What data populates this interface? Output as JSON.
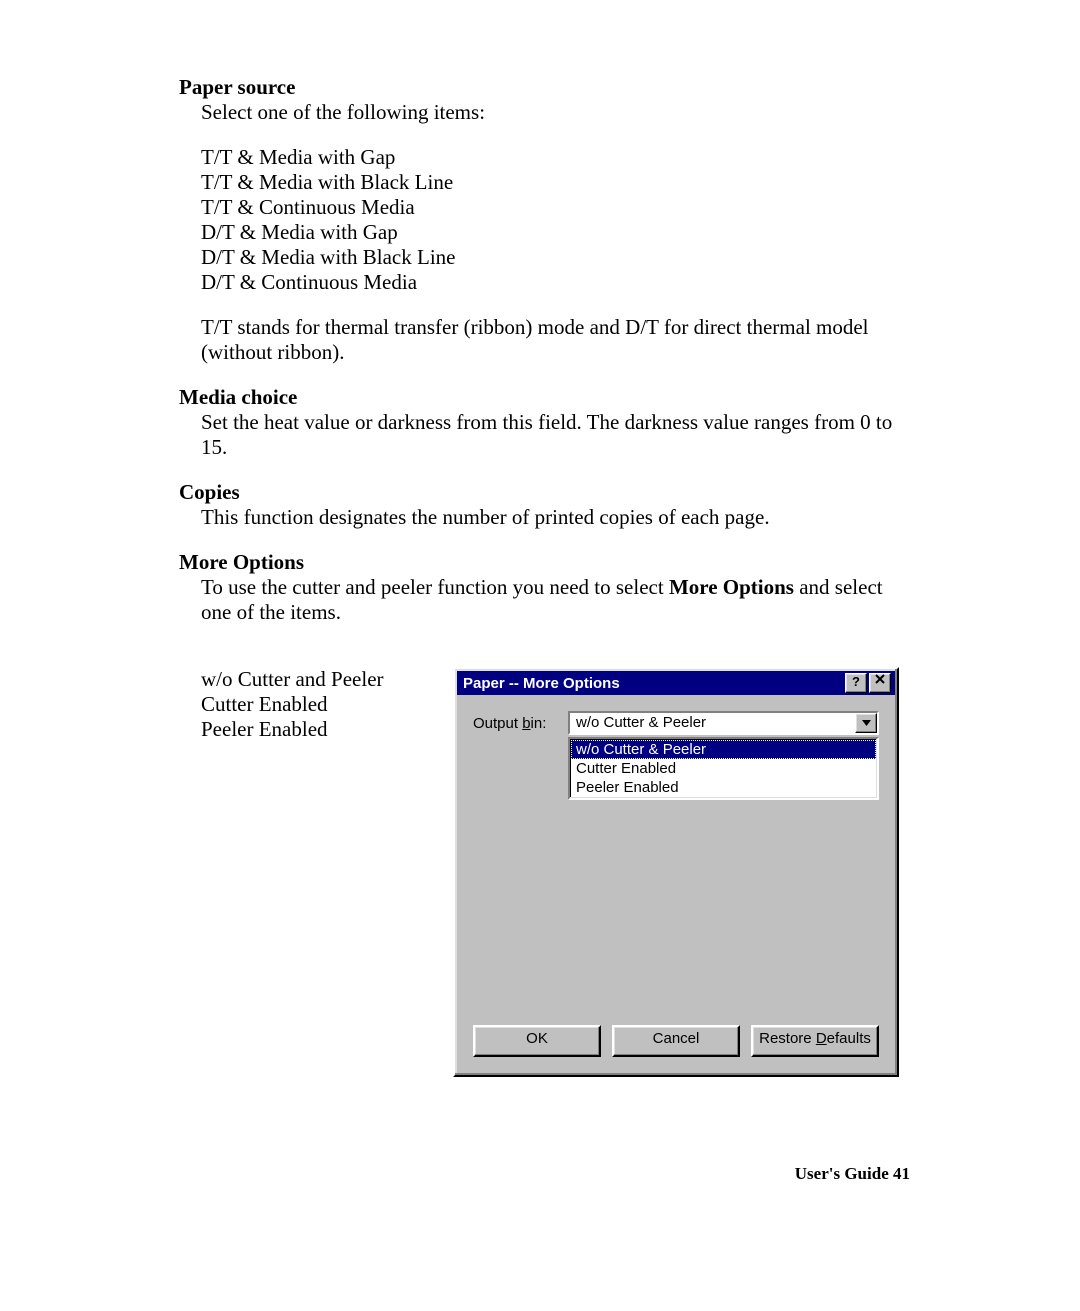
{
  "sections": {
    "paper_source": {
      "heading": "Paper source",
      "intro": "Select one of the following items:",
      "items": [
        "T/T & Media with Gap",
        "T/T & Media with Black Line",
        "T/T & Continuous Media",
        "D/T & Media with Gap",
        "D/T & Media with Black Line",
        "D/T & Continuous Media"
      ],
      "note": "T/T stands for thermal transfer (ribbon) mode and D/T for direct thermal model (without ribbon)."
    },
    "media_choice": {
      "heading": "Media choice",
      "text": "Set the heat value or darkness from this field.  The darkness value ranges from 0 to 15."
    },
    "copies": {
      "heading": "Copies",
      "text": "This function designates the number of printed copies of each page."
    },
    "more_options": {
      "heading": "More Options",
      "text_pre": "To use the cutter and peeler function you need to select ",
      "text_bold": "More Options",
      "text_post": " and select one of the items.",
      "left_items": [
        "w/o Cutter and Peeler",
        "Cutter Enabled",
        "Peeler Enabled"
      ]
    }
  },
  "dialog": {
    "title": "Paper -- More Options",
    "help_btn": "?",
    "close_btn": "×",
    "output_bin_label_pre": "Output ",
    "output_bin_label_ul": "b",
    "output_bin_label_post": "in:",
    "combo_selected": "w/o Cutter & Peeler",
    "dropdown": [
      {
        "text": "w/o Cutter & Peeler",
        "selected": true
      },
      {
        "text": "Cutter Enabled",
        "selected": false
      },
      {
        "text": "Peeler Enabled",
        "selected": false
      }
    ],
    "buttons": {
      "ok": "OK",
      "cancel": "Cancel",
      "restore_pre": "Restore ",
      "restore_ul": "D",
      "restore_post": "efaults"
    }
  },
  "footer": "User's Guide 41"
}
